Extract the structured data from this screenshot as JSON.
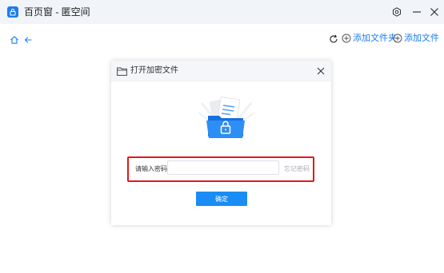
{
  "window": {
    "title": "百页窗 - 匿空间"
  },
  "toolbar": {
    "add_folder_label": "添加文件夹",
    "add_file_label": "添加文件"
  },
  "dialog": {
    "title": "打开加密文件",
    "password_label": "请输入密码",
    "password_value": "",
    "password_placeholder": "",
    "forgot_label": "忘记密码",
    "confirm_label": "确定"
  },
  "colors": {
    "accent": "#1a7cf3",
    "highlight_border": "#e0191b",
    "titlebar_bg": "#f1f4f8"
  },
  "icons": {
    "app": "lock-app-icon",
    "settings": "settings-icon",
    "minimize": "minimize-icon",
    "close": "close-icon",
    "home": "home-icon",
    "back": "back-arrow-icon",
    "refresh": "refresh-icon",
    "add": "plus-circle-icon",
    "folder": "folder-icon",
    "illustration": "locked-folder-icon"
  }
}
